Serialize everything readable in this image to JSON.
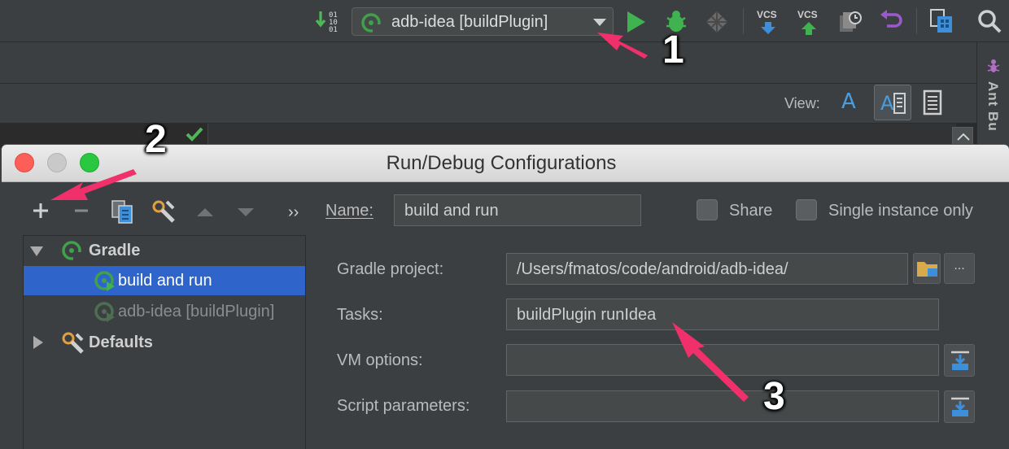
{
  "toolbar": {
    "run_config_label": "adb-idea [buildPlugin]",
    "vcs_update_label": "VCS",
    "vcs_commit_label": "VCS"
  },
  "right_panel": {
    "ant_build_label": "Ant Bu"
  },
  "view_bar": {
    "view_label": "View:",
    "text_view_glyph": "A"
  },
  "dialog": {
    "title": "Run/Debug Configurations",
    "tree": {
      "more_label": "››",
      "groups": [
        {
          "label": "Gradle",
          "expanded": true
        },
        {
          "label": "Defaults",
          "expanded": false
        }
      ],
      "items": [
        {
          "label": "build and run",
          "selected": true
        },
        {
          "label": "adb-idea [buildPlugin]",
          "selected": false
        }
      ]
    },
    "name_label": "Name:",
    "name_value": "build and run",
    "share_label": "Share",
    "single_instance_label": "Single instance only",
    "gradle_project_label": "Gradle project:",
    "gradle_project_value": "/Users/fmatos/code/android/adb-idea/",
    "browse_dots_label": "...",
    "tasks_label": "Tasks:",
    "tasks_value": "buildPlugin runIdea",
    "vm_options_label": "VM options:",
    "vm_options_value": "",
    "script_params_label": "Script parameters:",
    "script_params_value": ""
  },
  "annotations": {
    "callout_1": "1",
    "callout_2": "2",
    "callout_3": "3",
    "arrow_color": "#f0306a"
  },
  "colors": {
    "selection": "#2f65ca",
    "gradle_green": "#3fa14a",
    "run_green": "#3fb34f"
  }
}
